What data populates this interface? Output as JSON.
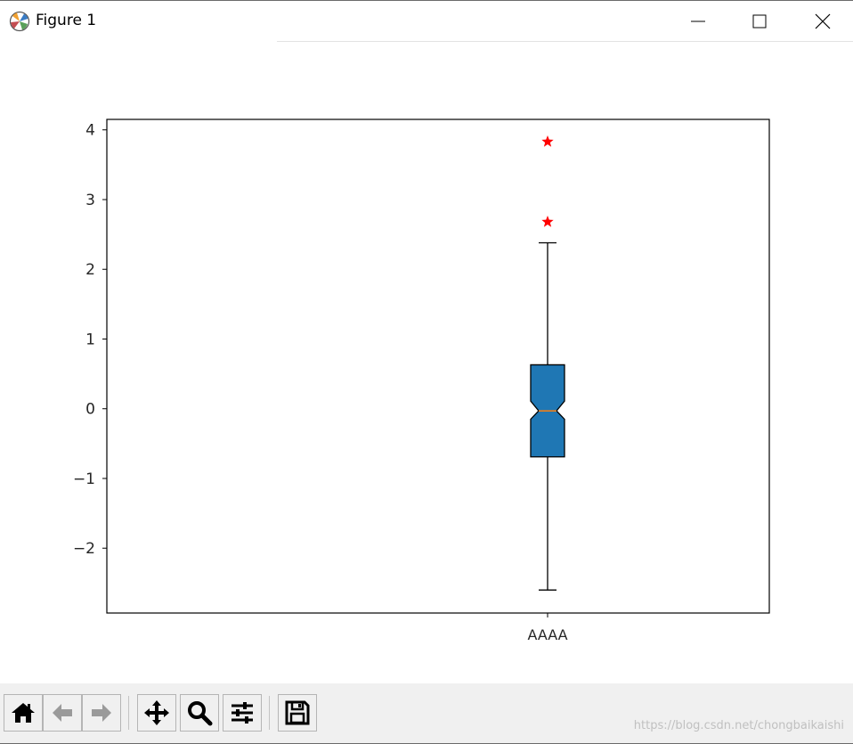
{
  "window": {
    "title": "Figure 1",
    "controls": [
      "minimize",
      "maximize",
      "close"
    ]
  },
  "toolbar": {
    "buttons": [
      {
        "name": "home",
        "icon": "home-icon"
      },
      {
        "name": "back",
        "icon": "back-arrow-icon"
      },
      {
        "name": "forward",
        "icon": "forward-arrow-icon"
      },
      {
        "name": "pan",
        "icon": "move-icon"
      },
      {
        "name": "zoom",
        "icon": "zoom-icon"
      },
      {
        "name": "configure",
        "icon": "sliders-icon"
      },
      {
        "name": "save",
        "icon": "save-icon"
      }
    ],
    "watermark": "https://blog.csdn.net/chongbaikaishi"
  },
  "chart_data": {
    "type": "box",
    "notched": true,
    "categories": [
      "AAAA"
    ],
    "box": {
      "whisker_low": -2.6,
      "q1": -0.69,
      "median": -0.03,
      "q3": 0.63,
      "whisker_high": 2.38,
      "notch_low": -0.15,
      "notch_high": 0.11,
      "outliers": [
        2.68,
        3.83
      ]
    },
    "ylim": [
      -2.93,
      4.15
    ],
    "yticks": [
      -2,
      -1,
      0,
      1,
      2,
      3,
      4
    ],
    "ytick_labels": [
      "−2",
      "−1",
      "0",
      "1",
      "2",
      "3",
      "4"
    ],
    "box_color": "#1f77b4",
    "median_color": "#ff7f0e",
    "outlier_color": "#ff0000",
    "outlier_marker": "star",
    "title": "",
    "xlabel": "",
    "ylabel": "",
    "grid": false
  }
}
